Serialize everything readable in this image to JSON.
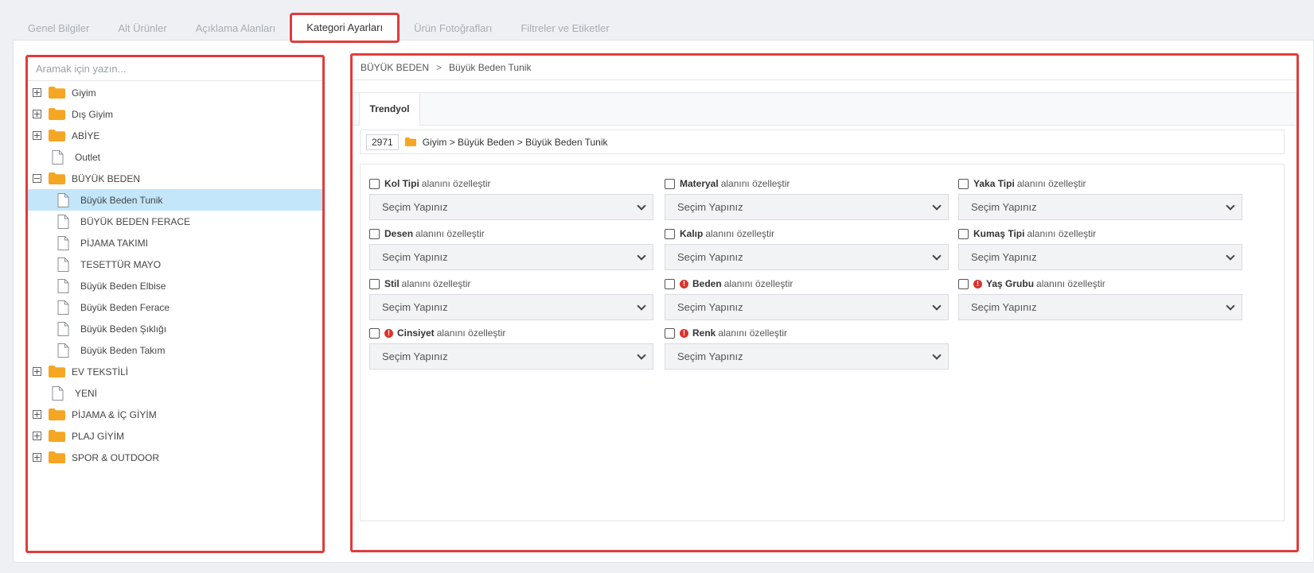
{
  "tabs": [
    {
      "label": "Genel Bilgiler",
      "active": false
    },
    {
      "label": "Alt Ürünler",
      "active": false
    },
    {
      "label": "Açıklama Alanları",
      "active": false
    },
    {
      "label": "Kategori Ayarları",
      "active": true
    },
    {
      "label": "Ürün Fotoğrafları",
      "active": false
    },
    {
      "label": "Filtreler ve Etiketler",
      "active": false
    }
  ],
  "search": {
    "placeholder": "Aramak için yazın..."
  },
  "tree": [
    {
      "label": "Giyim",
      "type": "folder",
      "expander": "plus"
    },
    {
      "label": "Dış Giyim",
      "type": "folder",
      "expander": "plus"
    },
    {
      "label": "ABİYE",
      "type": "folder",
      "expander": "plus"
    },
    {
      "label": "Outlet",
      "type": "file",
      "expander": "none"
    },
    {
      "label": "BÜYÜK BEDEN",
      "type": "folder",
      "expander": "minus"
    },
    {
      "label": "Büyük Beden Tunik",
      "type": "file",
      "child": true,
      "selected": true
    },
    {
      "label": "BÜYÜK BEDEN FERACE",
      "type": "file",
      "child": true
    },
    {
      "label": "PİJAMA TAKIMI",
      "type": "file",
      "child": true
    },
    {
      "label": "TESETTÜR MAYO",
      "type": "file",
      "child": true
    },
    {
      "label": "Büyük Beden Elbise",
      "type": "file",
      "child": true
    },
    {
      "label": "Büyük Beden Ferace",
      "type": "file",
      "child": true
    },
    {
      "label": "Büyük Beden Şıklığı",
      "type": "file",
      "child": true
    },
    {
      "label": "Büyük Beden Takım",
      "type": "file",
      "child": true
    },
    {
      "label": "EV TEKSTİLİ",
      "type": "folder",
      "expander": "plus"
    },
    {
      "label": "YENİ",
      "type": "file",
      "expander": "none"
    },
    {
      "label": "PİJAMA & İÇ GİYİM",
      "type": "folder",
      "expander": "plus"
    },
    {
      "label": "PLAJ GİYİM",
      "type": "folder",
      "expander": "plus"
    },
    {
      "label": "SPOR & OUTDOOR",
      "type": "folder",
      "expander": "plus"
    }
  ],
  "breadcrumb": {
    "parent": "BÜYÜK BEDEN",
    "separator": ">",
    "current": "Büyük Beden Tunik"
  },
  "subtab": {
    "label": "Trendyol"
  },
  "category_path": {
    "id": "2971",
    "path": "Giyim > Büyük Beden > Büyük Beden Tunik"
  },
  "label_suffix": "alanını özelleştir",
  "warn_symbol": "!",
  "fields": [
    {
      "name": "Kol Tipi",
      "required": false,
      "value": "Seçim Yapınız"
    },
    {
      "name": "Materyal",
      "required": false,
      "value": "Seçim Yapınız"
    },
    {
      "name": "Yaka Tipi",
      "required": false,
      "value": "Seçim Yapınız"
    },
    {
      "name": "Desen",
      "required": false,
      "value": "Seçim Yapınız"
    },
    {
      "name": "Kalıp",
      "required": false,
      "value": "Seçim Yapınız"
    },
    {
      "name": "Kumaş Tipi",
      "required": false,
      "value": "Seçim Yapınız"
    },
    {
      "name": "Stil",
      "required": false,
      "value": "Seçim Yapınız"
    },
    {
      "name": "Beden",
      "required": true,
      "value": "Seçim Yapınız"
    },
    {
      "name": "Yaş Grubu",
      "required": true,
      "value": "Seçim Yapınız"
    },
    {
      "name": "Cinsiyet",
      "required": true,
      "value": "Seçim Yapınız"
    },
    {
      "name": "Renk",
      "required": true,
      "value": "Seçim Yapınız"
    }
  ],
  "colors": {
    "highlight_border": "#e03c3c",
    "folder": "#f5a623",
    "selected_row": "#c3e6fb",
    "warning": "#d9342b"
  }
}
